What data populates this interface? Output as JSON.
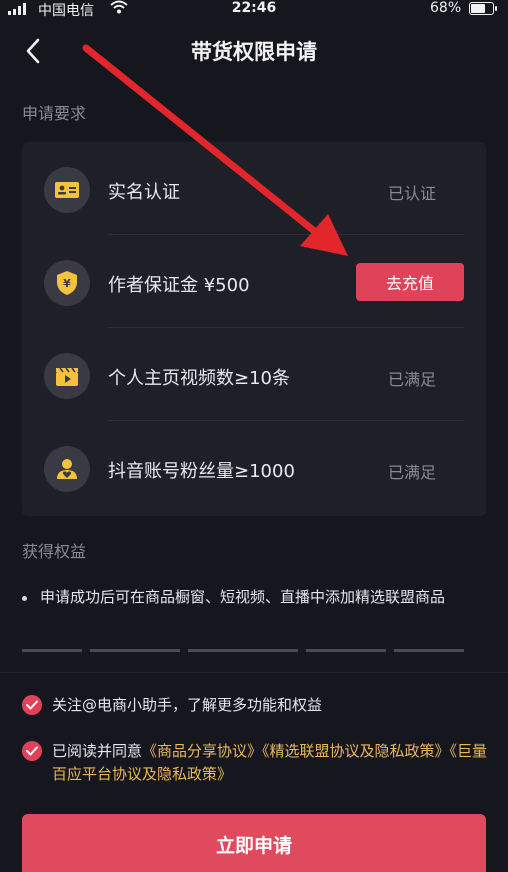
{
  "status_bar": {
    "carrier": "中国电信",
    "time": "22:46",
    "battery": "68%",
    "battery_level": 0.68
  },
  "header": {
    "title": "带货权限申请"
  },
  "requirements": {
    "section_label": "申请要求",
    "items": [
      {
        "label": "实名认证",
        "status": "已认证",
        "icon": "id-card-icon"
      },
      {
        "label": "作者保证金 ¥500",
        "action": "去充值",
        "icon": "yuan-shield-icon"
      },
      {
        "label": "个人主页视频数≥10条",
        "status": "已满足",
        "icon": "video-clapper-icon"
      },
      {
        "label": "抖音账号粉丝量≥1000",
        "status": "已满足",
        "icon": "fans-heart-icon"
      }
    ]
  },
  "benefits": {
    "section_label": "获得权益",
    "items": [
      "申请成功后可在商品橱窗、短视频、直播中添加精选联盟商品"
    ]
  },
  "agreements": {
    "follow_text": "关注@电商小助手，了解更多功能和权益",
    "read_prefix": "已阅读并同意",
    "link_1": "《商品分享协议》",
    "link_2": "《精选联盟协议及隐私政策》",
    "link_3": "《巨量百应平台协议及隐私政策》"
  },
  "submit_label": "立即申请",
  "colors": {
    "background": "#16161f",
    "card": "#1f1f28",
    "accent": "#e04259",
    "icon_gold": "#f5c33b",
    "link": "#e8b85a",
    "arrow": "#e3262b"
  }
}
